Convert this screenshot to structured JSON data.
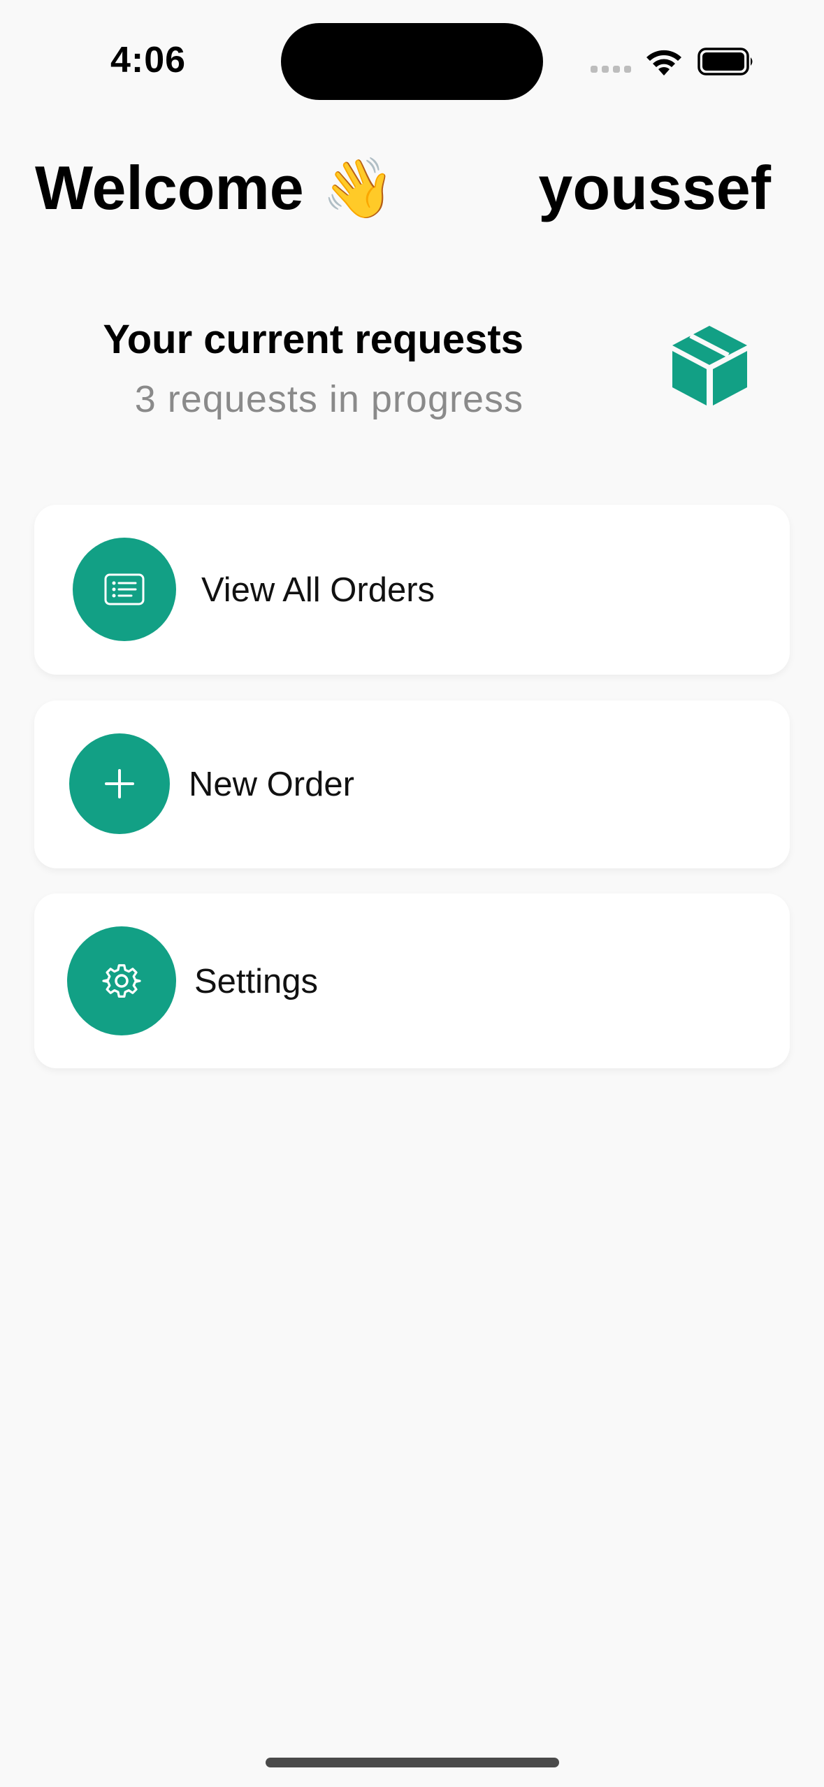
{
  "status_bar": {
    "time": "4:06"
  },
  "header": {
    "welcome": "Welcome",
    "wave_emoji": "👋",
    "username": "youssef"
  },
  "requests": {
    "title": "Your current requests",
    "subtitle": "3 requests in progress",
    "icon": "box-icon"
  },
  "menu": {
    "items": [
      {
        "label": "View All Orders",
        "icon": "list-document-icon"
      },
      {
        "label": "New Order",
        "icon": "plus-icon"
      },
      {
        "label": "Settings",
        "icon": "gear-icon"
      }
    ]
  },
  "colors": {
    "accent": "#12a085",
    "background": "#f9f9f9",
    "card": "#ffffff",
    "subtitle": "#8a8a8a"
  }
}
